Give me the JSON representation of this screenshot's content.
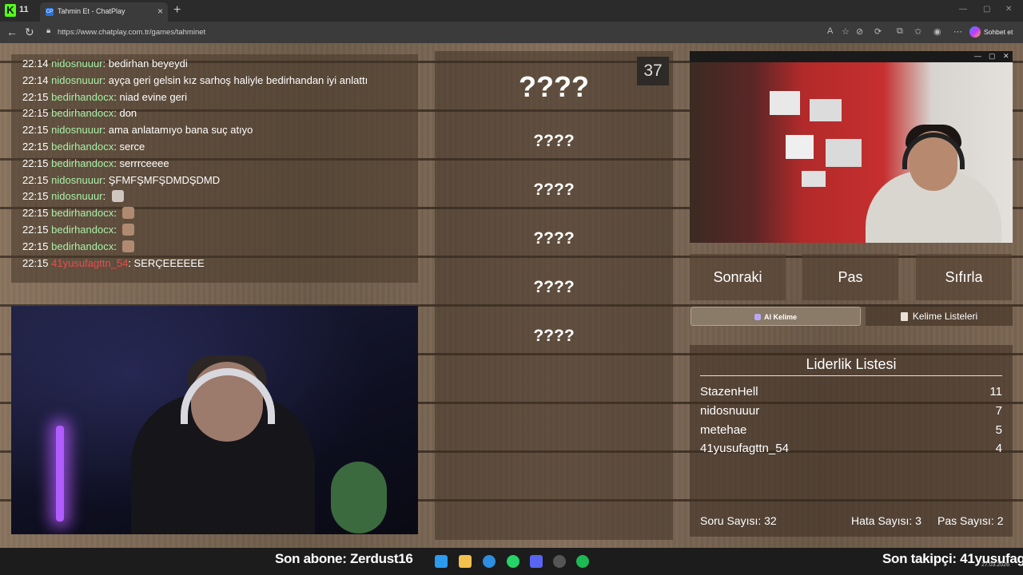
{
  "browser": {
    "app_mini_label": "11",
    "tab_title": "Tahmin Et - ChatPlay",
    "url": "https://www.chatplay.com.tr/games/tahminet",
    "copilot_label": "Sohbet et"
  },
  "chat": {
    "messages": [
      {
        "time": "22:14",
        "user": "nidosnuuur",
        "text": "bedirhan beyeydi",
        "color": "green"
      },
      {
        "time": "22:14",
        "user": "nidosnuuur",
        "text": "ayça geri gelsin kız sarhoş haliyle bedirhandan iyi anlattı",
        "color": "green"
      },
      {
        "time": "22:15",
        "user": "bedirhandocx",
        "text": "niad evine geri",
        "color": "green"
      },
      {
        "time": "22:15",
        "user": "bedirhandocx",
        "text": "don",
        "color": "green"
      },
      {
        "time": "22:15",
        "user": "nidosnuuur",
        "text": "ama anlatamıyo bana suç atıyo",
        "color": "green"
      },
      {
        "time": "22:15",
        "user": "bedirhandocx",
        "text": "serce",
        "color": "green"
      },
      {
        "time": "22:15",
        "user": "bedirhandocx",
        "text": "serrrceeee",
        "color": "green"
      },
      {
        "time": "22:15",
        "user": "nidosnuuur",
        "text": "ŞFMFŞMFŞDMDŞDMD",
        "color": "green"
      },
      {
        "time": "22:15",
        "user": "nidosnuuur",
        "text": "",
        "color": "green"
      },
      {
        "time": "22:15",
        "user": "bedirhandocx",
        "text": "",
        "color": "green"
      },
      {
        "time": "22:15",
        "user": "bedirhandocx",
        "text": "",
        "color": "green"
      },
      {
        "time": "22:15",
        "user": "bedirhandocx",
        "text": "",
        "color": "green"
      },
      {
        "time": "22:15",
        "user": "41yusufagttn_54",
        "text": "SERÇEEEEEE",
        "color": "red"
      }
    ]
  },
  "game": {
    "counter": "37",
    "main_word": "????",
    "hidden_words": [
      "????",
      "????",
      "????",
      "????",
      "????"
    ]
  },
  "controls": {
    "next_label": "Sonraki",
    "pass_label": "Pas",
    "reset_label": "Sıfırla",
    "ai_word_label": "AI Kelime",
    "word_lists_label": "Kelime Listeleri"
  },
  "leaderboard": {
    "title": "Liderlik Listesi",
    "rows": [
      {
        "name": "StazenHell",
        "score": "11"
      },
      {
        "name": "nidosnuuur",
        "score": "7"
      },
      {
        "name": "metehae",
        "score": "5"
      },
      {
        "name": "41yusufagttn_54",
        "score": "4"
      }
    ],
    "question_count": "Soru Sayısı: 32",
    "error_count": "Hata Sayısı: 3",
    "pass_count": "Pas Sayısı: 2"
  },
  "overlay": {
    "last_sub": "Son abone: Zerdust16",
    "last_follow": "Son takipçi: 41yusufag",
    "date": "27.03.2026"
  },
  "colors": {
    "username_green": "#a8f0a8",
    "username_red": "#e05050",
    "kick_green": "#53fc18"
  }
}
